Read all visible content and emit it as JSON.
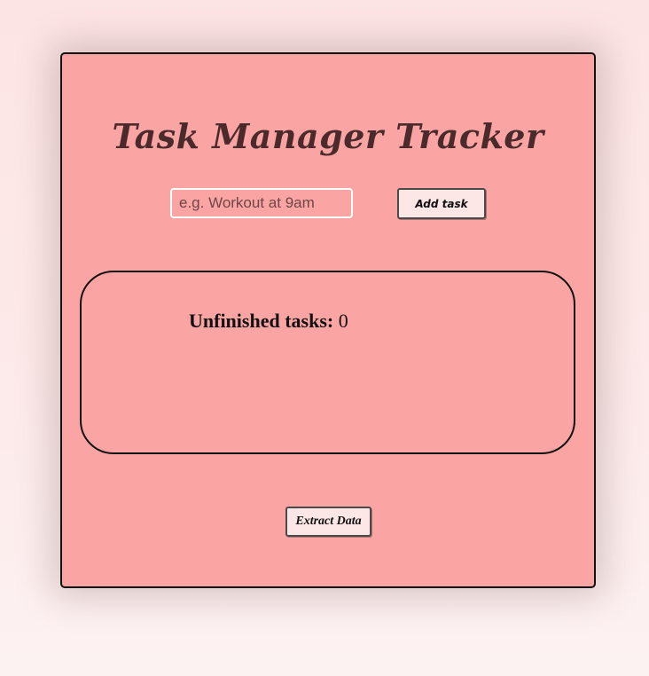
{
  "app": {
    "title": "Task Manager Tracker"
  },
  "task_form": {
    "input_placeholder": "e.g. Workout at 9am",
    "input_value": "",
    "add_button_label": "Add task"
  },
  "tasks": {
    "unfinished_label": "Unfinished tasks:",
    "unfinished_count": "0",
    "items": []
  },
  "actions": {
    "extract_button_label": "Extract Data"
  },
  "colors": {
    "page_background": "#fde4e4",
    "card_background": "#fba4a4",
    "title_color": "#4a2a2a",
    "button_background": "#fde6e6",
    "border": "#111111"
  }
}
